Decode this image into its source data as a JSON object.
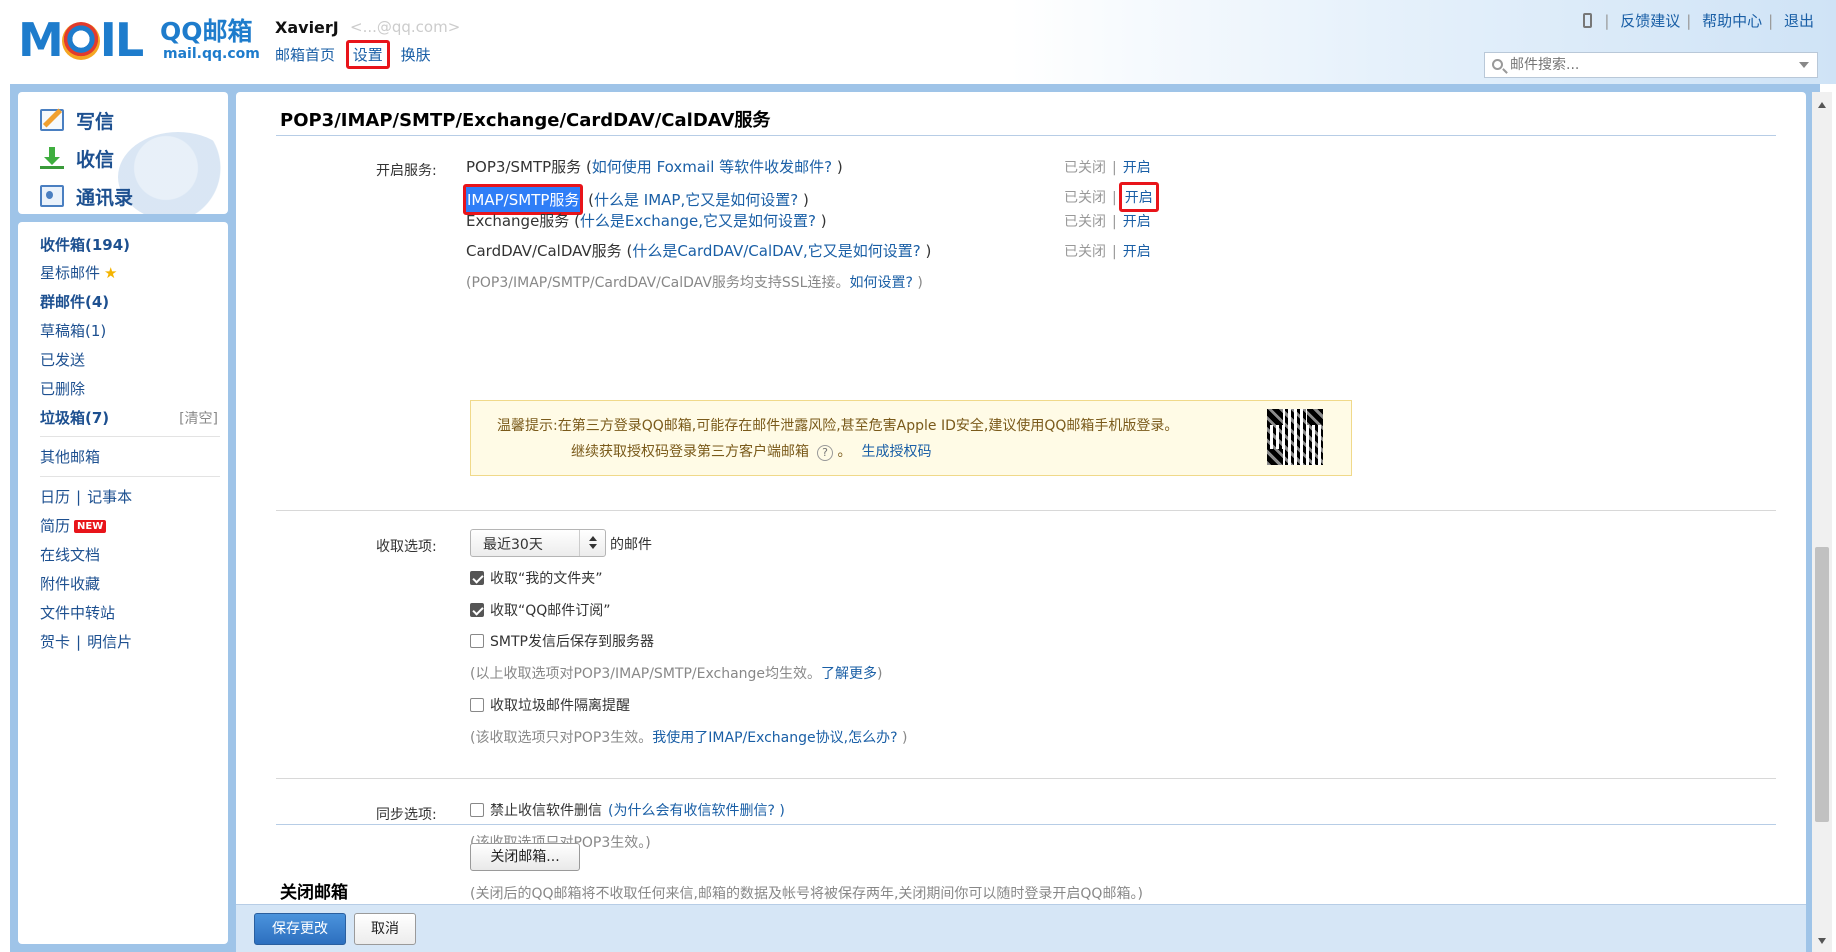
{
  "header": {
    "logo_text": "MOIl",
    "logo_name": "QQ邮箱",
    "logo_sub": "mail.qq.com",
    "user_name": "XavierJ",
    "user_email": "<...@qq.com>",
    "nav": [
      "邮箱首页",
      "设置",
      "换肤"
    ],
    "links": [
      "反馈建议",
      "帮助中心",
      "退出"
    ],
    "search_placeholder": "邮件搜索..."
  },
  "sidebar": {
    "top": [
      "写信",
      "收信",
      "通讯录"
    ],
    "inbox": "收件箱",
    "inbox_count": "(194)",
    "starred": "星标邮件",
    "group": "群邮件",
    "group_count": "(4)",
    "drafts": "草稿箱(1)",
    "sent": "已发送",
    "deleted": "已删除",
    "spam": "垃圾箱",
    "spam_count": "(7)",
    "spam_clear": "[清空]",
    "other": "其他邮箱",
    "calendar": "日历",
    "notes": "记事本",
    "resume": "简历",
    "new_badge": "NEW",
    "docs": "在线文档",
    "attachments": "附件收藏",
    "transfer": "文件中转站",
    "cards": "贺卡",
    "postcards": "明信片"
  },
  "main": {
    "section1_title": "POP3/IMAP/SMTP/Exchange/CardDAV/CalDAV服务",
    "enable_label": "开启服务:",
    "services": [
      {
        "name": "POP3/SMTP服务",
        "open_paren": " (",
        "help": "如何使用 Foxmail 等软件收发邮件?",
        "close_paren": " )",
        "status": "已关闭",
        "action": "开启"
      },
      {
        "name": "IMAP/SMTP服务",
        "open_paren": " (",
        "help": "什么是 IMAP,它又是如何设置?",
        "close_paren": " )",
        "status": "已关闭",
        "action": "开启"
      },
      {
        "name": "Exchange服务",
        "open_paren": " (",
        "help": "什么是Exchange,它又是如何设置?",
        "close_paren": " )",
        "status": "已关闭",
        "action": "开启"
      },
      {
        "name": "CardDAV/CalDAV服务",
        "open_paren": " (",
        "help": "什么是CardDAV/CalDAV,它又是如何设置?",
        "close_paren": " )",
        "status": "已关闭",
        "action": "开启"
      }
    ],
    "ssl_note_prefix": "(POP3/IMAP/SMTP/CardDAV/CalDAV服务均支持SSL连接。",
    "ssl_note_link": "如何设置?",
    "ssl_note_suffix": " )",
    "tip_line1": "温馨提示:在第三方登录QQ邮箱,可能存在邮件泄露风险,甚至危害Apple ID安全,建议使用QQ邮箱手机版登录。",
    "tip_line2": "继续获取授权码登录第三方客户端邮箱",
    "tip_q": "?",
    "tip_period": " 。",
    "tip_link": "生成授权码",
    "receive_label": "收取选项:",
    "receive_select": "最近30天",
    "receive_suffix": "的邮件",
    "cb_my_folders": "收取“我的文件夹”",
    "cb_subscriptions": "收取“QQ邮件订阅”",
    "cb_smtp_save": "SMTP发信后保存到服务器",
    "receive_note_prefix": "(以上收取选项对POP3/IMAP/SMTP/Exchange均生效。",
    "receive_note_link": "了解更多",
    "receive_note_suffix": ")",
    "cb_spam_isolation": "收取垃圾邮件隔离提醒",
    "spam_note_prefix": "(该收取选项只对POP3生效。",
    "spam_note_link": "我使用了IMAP/Exchange协议,怎么办?",
    "spam_note_suffix": " )",
    "sync_label": "同步选项:",
    "cb_no_delete": "禁止收信软件删信",
    "no_delete_link": "(为什么会有收信软件删信? )",
    "sync_note": "(该收取选项只对POP3生效。)",
    "section2_title": "关闭邮箱",
    "close_button": "关闭邮箱...",
    "close_note": "(关闭后的QQ邮箱将不收取任何来信,邮箱的数据及帐号将被保存两年,关闭期间你可以随时登录开启QQ邮箱。)"
  },
  "footer": {
    "save": "保存更改",
    "cancel": "取消"
  },
  "colors": {
    "brand_blue": "#1e7ccc",
    "link_blue": "#1a5fa6",
    "highlight_red": "#e8141a",
    "frame_blue": "#9fc4e8"
  }
}
